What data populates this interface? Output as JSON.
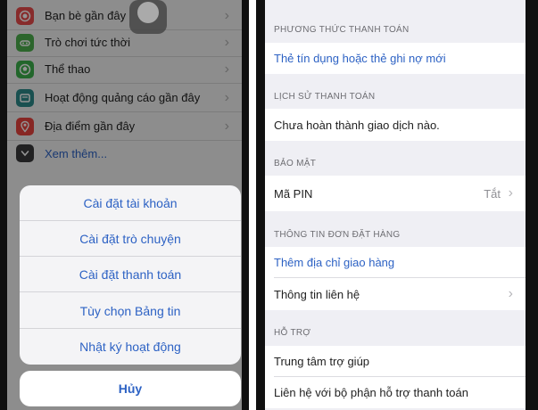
{
  "left": {
    "menu_items": [
      {
        "label": "Bạn bè gần đây",
        "icon": "nearby-friends-icon",
        "color": "#e94a4a"
      },
      {
        "label": "Trò chơi tức thời",
        "icon": "instant-games-icon",
        "color": "#4cae4c"
      },
      {
        "label": "Thể thao",
        "icon": "sports-icon",
        "color": "#3cb04a"
      },
      {
        "label": "Hoạt động quảng cáo gần đây",
        "icon": "recent-ad-activity-icon",
        "color": "#2c8b8b"
      },
      {
        "label": "Địa điểm gần đây",
        "icon": "nearby-places-icon",
        "color": "#e9443f"
      },
      {
        "label": "Xem thêm...",
        "icon": "chevron-down-icon",
        "color": "#3a3a3c"
      }
    ],
    "action_sheet": {
      "items": [
        "Cài đặt tài khoản",
        "Cài đặt trò chuyện",
        "Cài đặt thanh toán",
        "Tùy chọn Bảng tin",
        "Nhật ký hoạt động"
      ],
      "cancel": "Hủy"
    }
  },
  "right": {
    "payment_method": {
      "header": "PHƯƠNG THỨC THANH TOÁN",
      "add_card": "Thẻ tín dụng hoặc thẻ ghi nợ mới"
    },
    "payment_history": {
      "header": "LỊCH SỬ THANH TOÁN",
      "empty_text": "Chưa hoàn thành giao dịch nào."
    },
    "security": {
      "header": "BẢO MẬT",
      "pin_label": "Mã PIN",
      "pin_value": "Tắt"
    },
    "order_info": {
      "header": "THÔNG TIN ĐƠN ĐẶT HÀNG",
      "add_address": "Thêm địa chỉ giao hàng",
      "contact_info": "Thông tin liên hệ"
    },
    "support": {
      "header": "HỖ TRỢ",
      "help_center": "Trung tâm trợ giúp",
      "contact_payment_support": "Liên hệ với bộ phận hỗ trợ thanh toán"
    }
  },
  "colors": {
    "link_blue": "#2d62c4",
    "grouped_background": "#efeff4",
    "overlay_dim": "rgba(0,0,0,0.42)"
  }
}
